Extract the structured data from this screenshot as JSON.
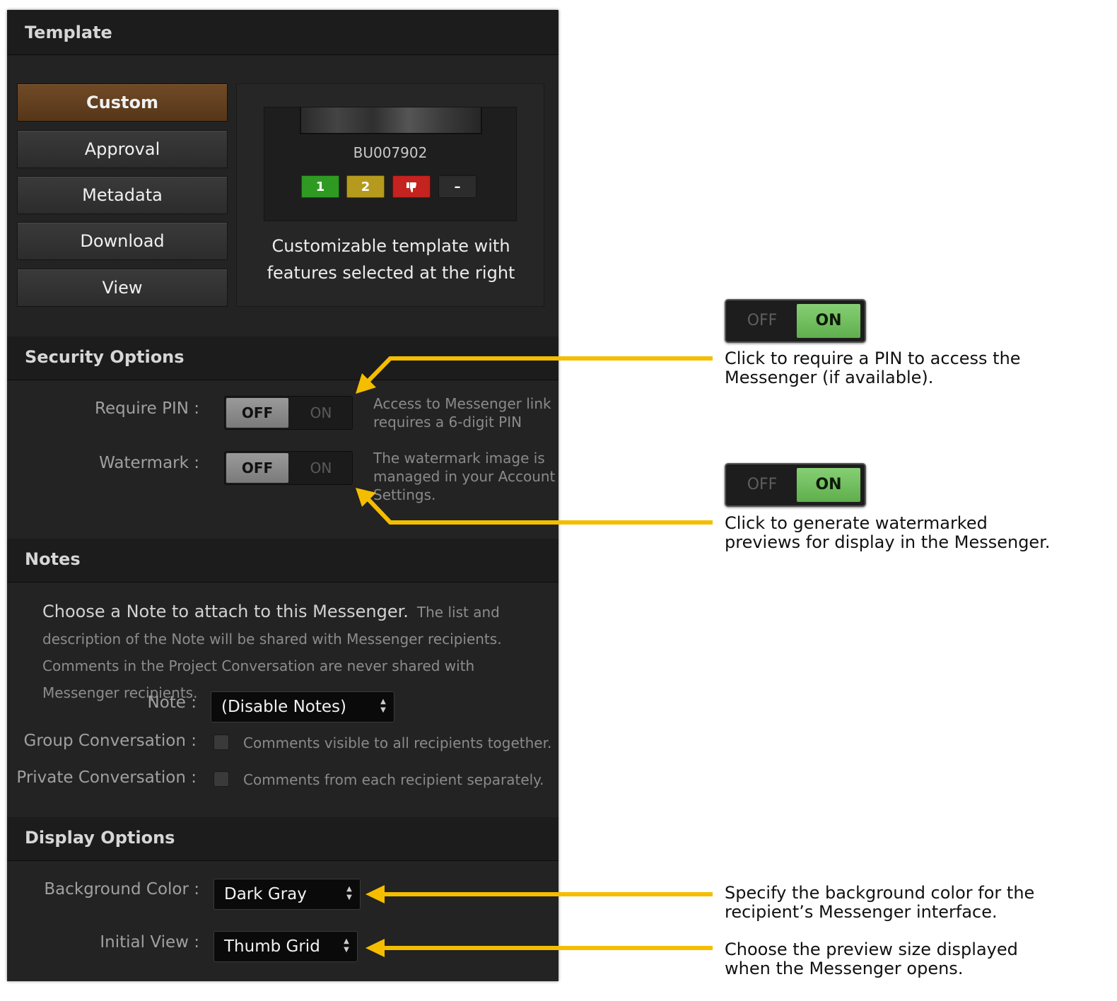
{
  "template": {
    "header": "Template",
    "buttons": [
      "Custom",
      "Approval",
      "Metadata",
      "Download",
      "View"
    ],
    "active_index": 0,
    "preview": {
      "asset_name": "BU007902",
      "chips": [
        {
          "label": "1",
          "color": "#2e9a22"
        },
        {
          "label": "2",
          "color": "#b59a1d"
        },
        {
          "label": "",
          "color": "#c4231f",
          "icon": "thumbs-down-icon"
        },
        {
          "label": "–",
          "color": "#2c2c2c"
        }
      ],
      "description_line1": "Customizable template with",
      "description_line2": "features selected at the right"
    }
  },
  "security": {
    "header": "Security Options",
    "require_pin": {
      "label": "Require PIN :",
      "off": "OFF",
      "on": "ON",
      "hint_line1": "Access to Messenger link",
      "hint_line2": "requires a 6-digit PIN"
    },
    "watermark": {
      "label": "Watermark :",
      "off": "OFF",
      "on": "ON",
      "hint_line1": "The watermark image is",
      "hint_line2": "managed in your Account",
      "hint_line3": "Settings."
    }
  },
  "notes": {
    "header": "Notes",
    "lead": "Choose a Note to attach to this Messenger.",
    "body": "The list and description of the Note will be shared with Messenger recipients. Comments in the Project Conversation are never shared with Messenger recipients.",
    "note_label": "Note :",
    "note_value": "(Disable Notes)",
    "group_label": "Group Conversation :",
    "group_hint": "Comments visible to all recipients together.",
    "private_label": "Private Conversation :",
    "private_hint": "Comments from each recipient separately."
  },
  "display": {
    "header": "Display Options",
    "bg_label": "Background Color :",
    "bg_value": "Dark Gray",
    "view_label": "Initial View :",
    "view_value": "Thumb Grid"
  },
  "annotations": {
    "pin_toggle": {
      "off": "OFF",
      "on": "ON"
    },
    "pin_text_line1": "Click to require a PIN to access the",
    "pin_text_line2": "Messenger (if available).",
    "wm_toggle": {
      "off": "OFF",
      "on": "ON"
    },
    "wm_text_line1": "Click to generate watermarked",
    "wm_text_line2": "previews for display in the Messenger.",
    "bg_text_line1": "Specify the background color for the",
    "bg_text_line2": "recipient’s Messenger interface.",
    "view_text_line1": "Choose the preview size displayed",
    "view_text_line2": "when the Messenger opens.",
    "arrow_color": "#f5bd00"
  }
}
